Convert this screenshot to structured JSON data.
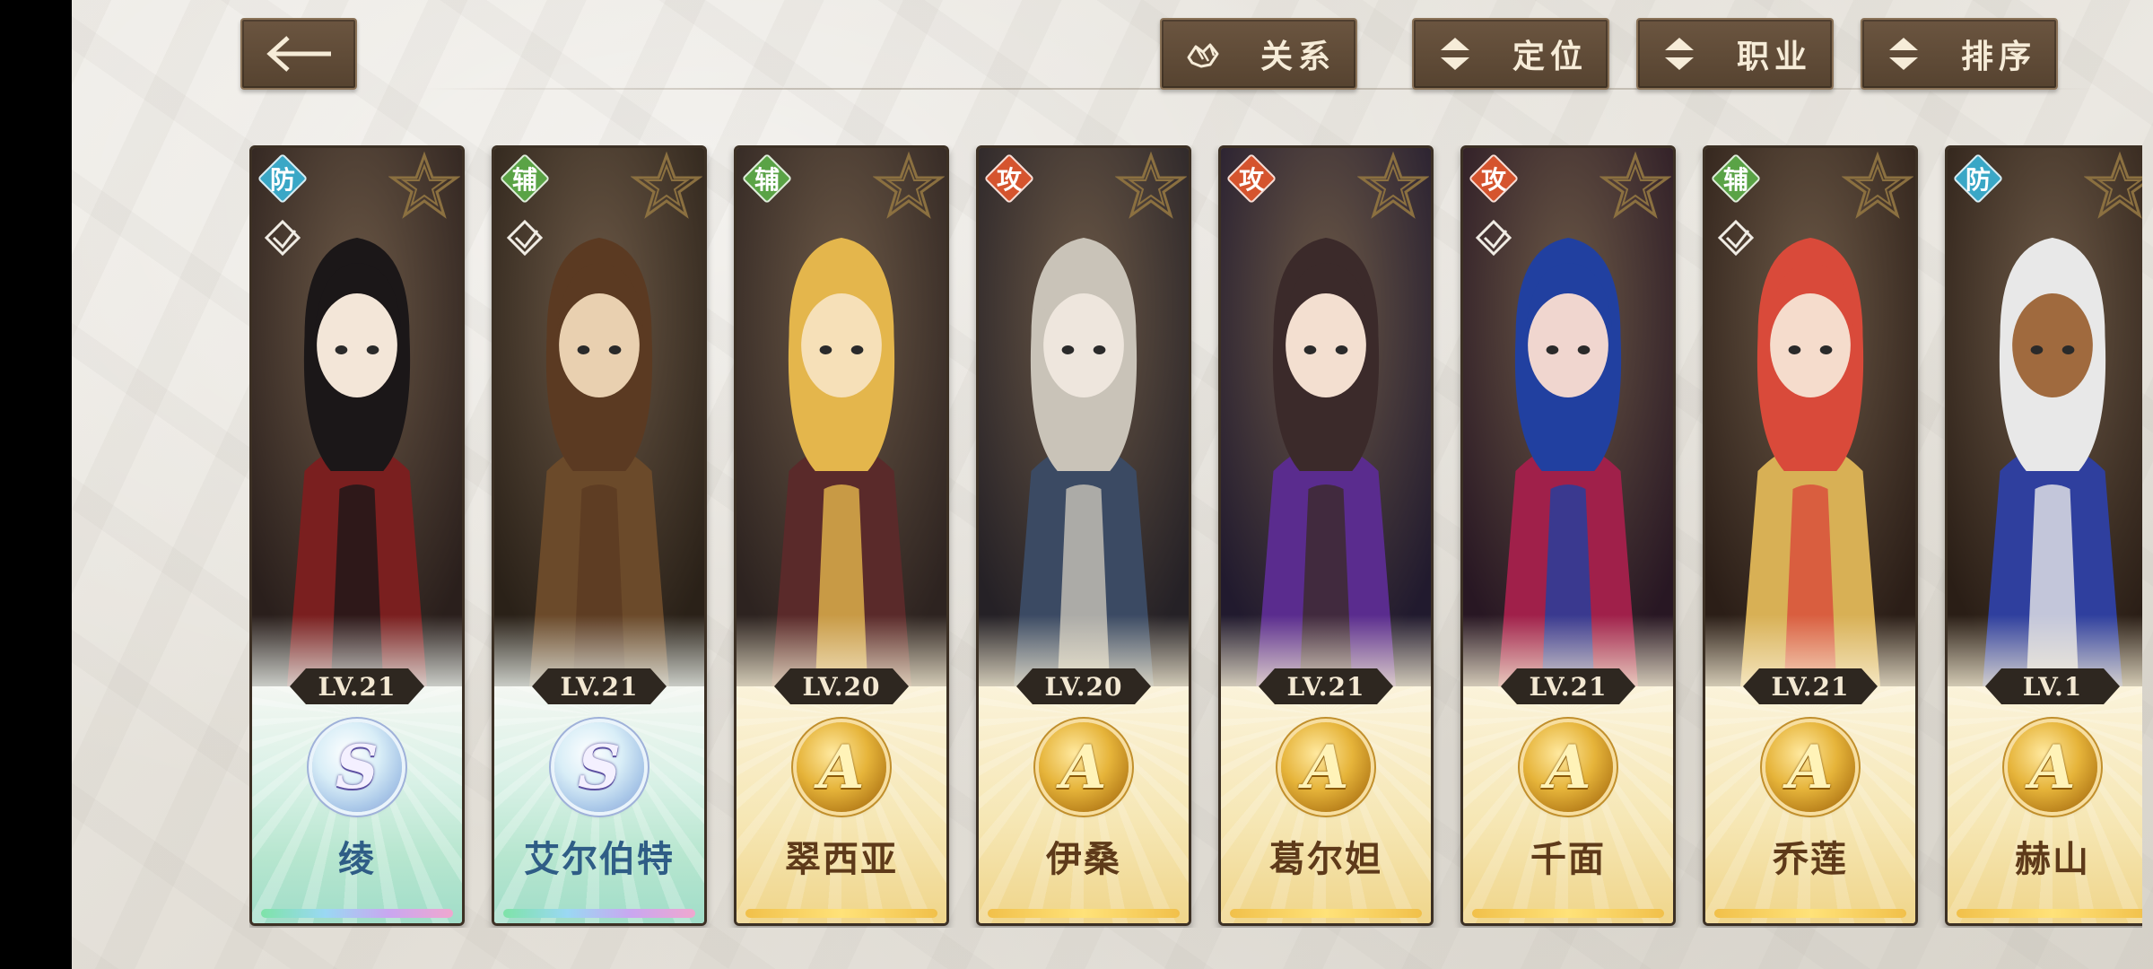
{
  "toolbar": {
    "relation": {
      "label": "关系",
      "icon": "hands-icon"
    },
    "position": {
      "label": "定位",
      "icon": "sort-arrows-icon"
    },
    "profession": {
      "label": "职业",
      "icon": "sort-arrows-icon"
    },
    "sort": {
      "label": "排序",
      "icon": "sort-arrows-icon"
    }
  },
  "colors": {
    "button_bg": "#5e4a35",
    "button_text": "#f6ecd8",
    "role_defense": "#3aa7c6",
    "role_support": "#5aa346",
    "role_attack": "#d5542e",
    "name_gold": "#5e3a1a",
    "name_s": "#2f5d86"
  },
  "characters": [
    {
      "name": "绫",
      "level": "LV.21",
      "role": "防",
      "rank": "S"
    },
    {
      "name": "艾尔伯特",
      "level": "LV.21",
      "role": "辅",
      "rank": "S"
    },
    {
      "name": "翠西亚",
      "level": "LV.20",
      "role": "辅",
      "rank": "A"
    },
    {
      "name": "伊桑",
      "level": "LV.20",
      "role": "攻",
      "rank": "A"
    },
    {
      "name": "葛尔妲",
      "level": "LV.21",
      "role": "攻",
      "rank": "A"
    },
    {
      "name": "千面",
      "level": "LV.21",
      "role": "攻",
      "rank": "A"
    },
    {
      "name": "乔莲",
      "level": "LV.21",
      "role": "辅",
      "rank": "A"
    },
    {
      "name": "赫山",
      "level": "LV.1",
      "role": "防",
      "rank": "A"
    }
  ]
}
